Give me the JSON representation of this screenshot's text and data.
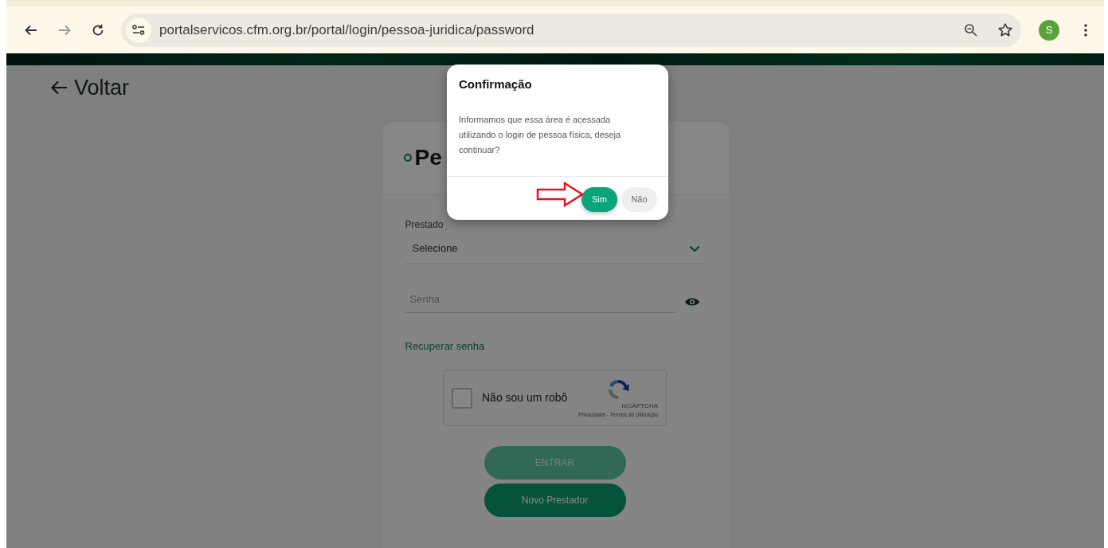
{
  "browser": {
    "url": "portalservicos.cfm.org.br/portal/login/pessoa-juridica/password",
    "profile_initial": "S"
  },
  "page": {
    "back_link": "Voltar",
    "card": {
      "title": "Pe",
      "provider_label": "Prestado",
      "provider_select": {
        "value": "Selecione"
      },
      "password": {
        "placeholder": "Senha"
      },
      "recover_link": "Recuperar senha",
      "captcha": {
        "label": "Não sou um robô",
        "checked": false,
        "brand": "reCAPTCHA",
        "links": "Privacidade - Termos de Utilização"
      },
      "buttons": [
        {
          "label": "ENTRAR",
          "disabled": true
        },
        {
          "label": "Novo Prestador",
          "disabled": false
        }
      ]
    }
  },
  "dialog": {
    "title": "Confirmação",
    "message": "Informamos que essa área é acessada utilizando o login de pessoa física, deseja continuar?",
    "buttons": [
      {
        "label": "Sim",
        "kind": "primary"
      },
      {
        "label": "Não",
        "kind": "secondary"
      }
    ]
  }
}
